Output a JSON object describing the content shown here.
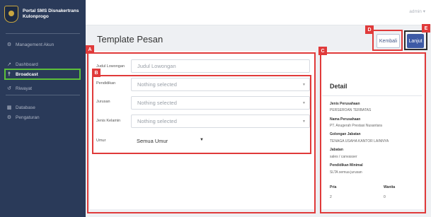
{
  "app": {
    "brand_line1": "Portal SMS Disnakertrans",
    "brand_line2": "Kulonprogo",
    "user": "admin ▾"
  },
  "sidebar": {
    "items": [
      {
        "label": "Management Akun",
        "icon": "users-icon"
      },
      {
        "label": "Dashboard",
        "icon": "chart-icon"
      },
      {
        "label": "Broadcast",
        "icon": "broadcast-icon",
        "active": true
      },
      {
        "label": "Riwayat",
        "icon": "history-icon"
      },
      {
        "label": "Database",
        "icon": "database-icon"
      },
      {
        "label": "Pengaturan",
        "icon": "gear-icon"
      }
    ]
  },
  "page": {
    "title": "Template Pesan",
    "kembali_label": "Kembali",
    "lanjut_label": "Lanjut"
  },
  "form": {
    "judul_label": "Judul Lowongan",
    "judul_placeholder": "Judul Lowongan",
    "pendidikan_label": "Pendidikan",
    "pendidikan_value": "Nothing selected",
    "jurusan_label": "Jurusan",
    "jurusan_value": "Nothing selected",
    "jenis_kelamin_label": "Jenis Kelamin",
    "jenis_kelamin_value": "Nothing selected",
    "umur_label": "Umur",
    "umur_value": "Semua Umur"
  },
  "detail": {
    "title": "Detail",
    "jenis_perusahaan_label": "Jenis Perusahaan",
    "jenis_perusahaan_value": "PERSEROAN TERBATAS",
    "nama_perusahaan_label": "Nama Perusahaan",
    "nama_perusahaan_value": "PT. Anugerah Prestasi Nusantara",
    "golongan_label": "Golongan Jabatan",
    "golongan_value": "TENAGA USAHA KANTOR LAINNYA",
    "jabatan_label": "Jabatan",
    "jabatan_value": "sales / canvasser",
    "pendidikan_label": "Pendidikan Minimal",
    "pendidikan_value": "SLTA semua jurusan",
    "pria_label": "Pria",
    "pria_value": "2",
    "wanita_label": "Wanita",
    "wanita_value": "0"
  },
  "annotations": {
    "a": "A",
    "b": "B",
    "c": "C",
    "d": "D",
    "e": "E"
  },
  "colors": {
    "sidebar_bg": "#2a3a59",
    "primary": "#3d5aa5",
    "annotation_red": "#e03a3a",
    "active_highlight": "#5cbf3a"
  }
}
